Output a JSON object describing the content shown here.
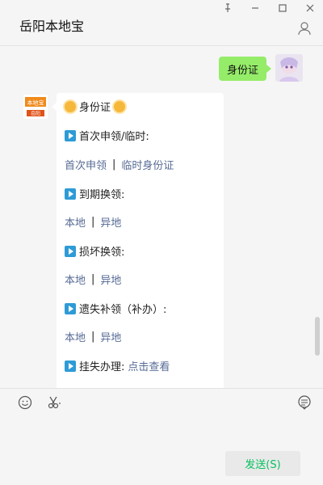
{
  "window": {
    "title": "岳阳本地宝",
    "controls": [
      "pin-icon",
      "minimize-icon",
      "maximize-icon",
      "close-icon"
    ]
  },
  "chat": {
    "user_message": "身份证",
    "bot": {
      "logo_text_top": "本地宝",
      "logo_text_bottom": "岳阳",
      "heading": "身份证",
      "sections": [
        {
          "label": "首次申领/临时:",
          "links": [
            "首次申领",
            "临时身份证"
          ]
        },
        {
          "label": "到期换领:",
          "links": [
            "本地",
            "异地"
          ]
        },
        {
          "label": "损坏换领:",
          "links": [
            "本地",
            "异地"
          ]
        },
        {
          "label": "遗失补领（补办）:",
          "links": [
            "本地",
            "异地"
          ]
        }
      ],
      "last_item": {
        "label": "挂失办理:",
        "link": "点击查看"
      },
      "separator": "|"
    }
  },
  "input": {
    "send_label": "发送(S)",
    "icons": [
      "emoji-icon",
      "scissors-icon",
      "voice-icon"
    ]
  },
  "colors": {
    "user_bubble": "#95ec69",
    "link": "#576b95",
    "send_text": "#07c160",
    "background": "#f5f5f5"
  }
}
